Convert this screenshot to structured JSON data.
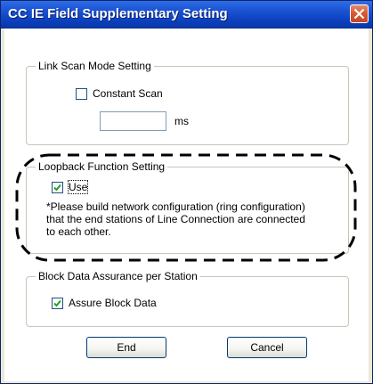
{
  "window": {
    "title": "CC IE Field Supplementary Setting"
  },
  "link_scan": {
    "group_label": "Link Scan Mode Setting",
    "constant_scan_label": "Constant Scan",
    "constant_scan_checked": false,
    "value": "",
    "unit": "ms"
  },
  "loopback": {
    "group_label": "Loopback Function Setting",
    "use_label": "Use",
    "use_checked": true,
    "note_lines": [
      "*Please build network configuration (ring configuration)",
      "that the end stations of Line Connection are connected",
      "to each other."
    ]
  },
  "block_data": {
    "group_label": "Block Data Assurance per Station",
    "assure_label": "Assure Block Data",
    "assure_checked": true
  },
  "buttons": {
    "end": "End",
    "cancel": "Cancel"
  },
  "colors": {
    "titlebar": "#0b3fbd",
    "close_button": "#d65b34",
    "checkbox_mark": "#21a121"
  }
}
